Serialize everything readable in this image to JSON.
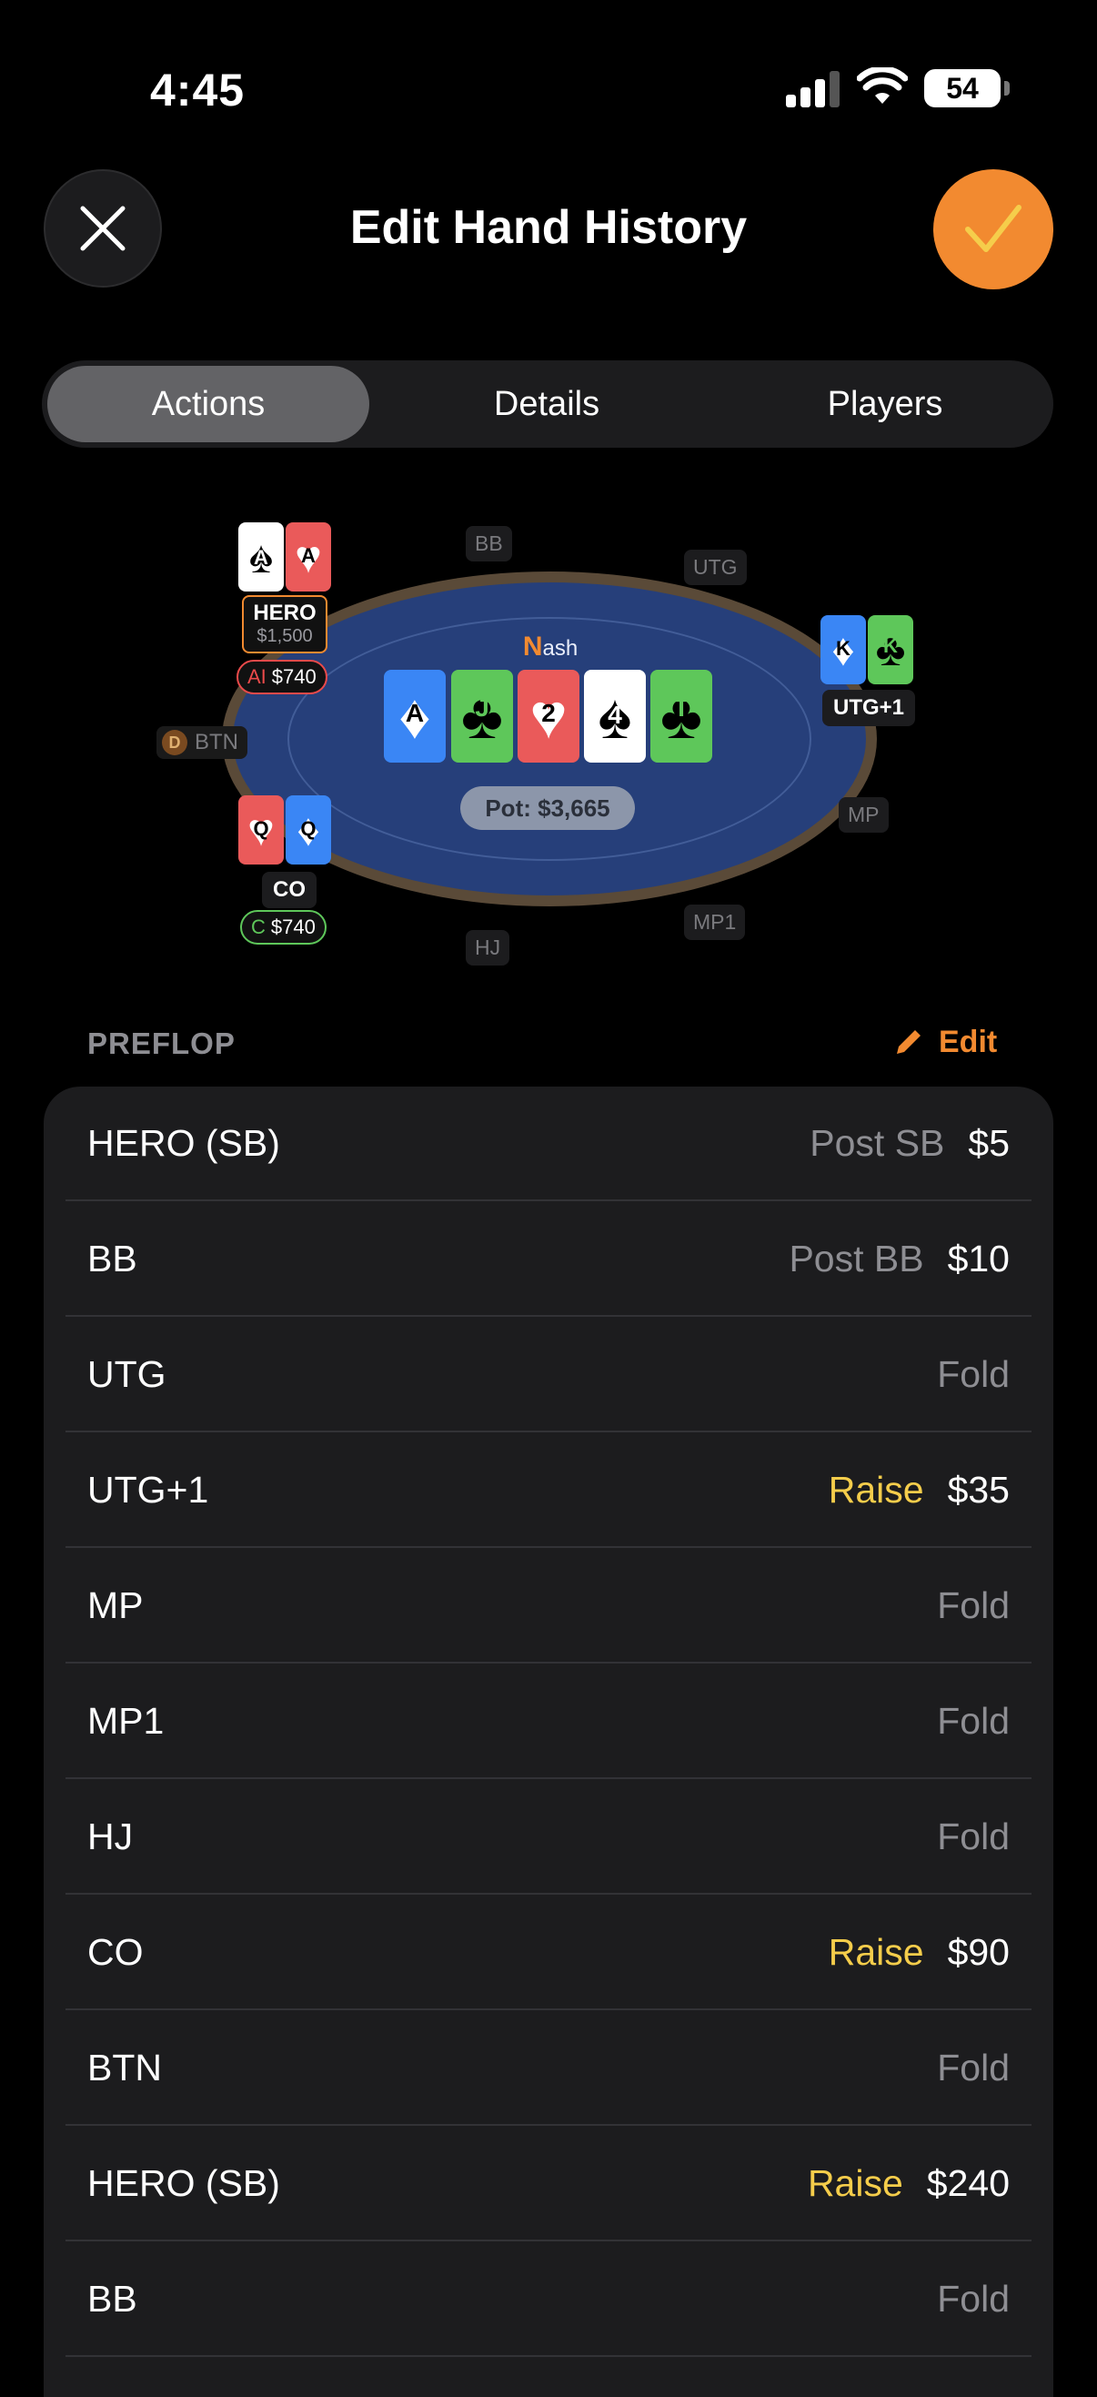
{
  "status_bar": {
    "time": "4:45",
    "battery": "54"
  },
  "header": {
    "title": "Edit Hand History"
  },
  "tabs": [
    {
      "label": "Actions",
      "active": true
    },
    {
      "label": "Details",
      "active": false
    },
    {
      "label": "Players",
      "active": false
    }
  ],
  "table": {
    "name_initial": "N",
    "name_rest": "ash",
    "pot": "Pot: $3,665",
    "board": [
      {
        "rank": "A",
        "suit": "diamond",
        "color": "blue"
      },
      {
        "rank": "J",
        "suit": "club",
        "color": "green"
      },
      {
        "rank": "2",
        "suit": "heart",
        "color": "red"
      },
      {
        "rank": "4",
        "suit": "spade",
        "color": "white"
      },
      {
        "rank": "T",
        "suit": "club",
        "color": "green"
      }
    ],
    "seats": {
      "bb": "BB",
      "utg": "UTG",
      "mp": "MP",
      "mp1": "MP1",
      "hj": "HJ",
      "btn_dealer": "D",
      "btn": "BTN",
      "utg1": "UTG+1",
      "co": "CO",
      "hero_name": "HERO",
      "hero_stack": "$1,500"
    },
    "hero_tag": {
      "action": "AI",
      "amount": "$740"
    },
    "co_tag": {
      "action": "C",
      "amount": "$740"
    },
    "hero_cards": [
      "A",
      "A"
    ],
    "utg1_cards": [
      "K",
      "K"
    ],
    "co_cards": [
      "Q",
      "Q"
    ]
  },
  "preflop": {
    "label": "PREFLOP",
    "edit_label": "Edit",
    "rows": [
      {
        "player": "HERO (SB)",
        "action": "Post SB",
        "amount": "$5",
        "style": "gray"
      },
      {
        "player": "BB",
        "action": "Post BB",
        "amount": "$10",
        "style": "gray"
      },
      {
        "player": "UTG",
        "action": "Fold",
        "amount": "",
        "style": "gray"
      },
      {
        "player": "UTG+1",
        "action": "Raise",
        "amount": "$35",
        "style": "yellow"
      },
      {
        "player": "MP",
        "action": "Fold",
        "amount": "",
        "style": "gray"
      },
      {
        "player": "MP1",
        "action": "Fold",
        "amount": "",
        "style": "gray"
      },
      {
        "player": "HJ",
        "action": "Fold",
        "amount": "",
        "style": "gray"
      },
      {
        "player": "CO",
        "action": "Raise",
        "amount": "$90",
        "style": "yellow"
      },
      {
        "player": "BTN",
        "action": "Fold",
        "amount": "",
        "style": "gray"
      },
      {
        "player": "HERO (SB)",
        "action": "Raise",
        "amount": "$240",
        "style": "yellow"
      },
      {
        "player": "BB",
        "action": "Fold",
        "amount": "",
        "style": "gray"
      }
    ]
  }
}
